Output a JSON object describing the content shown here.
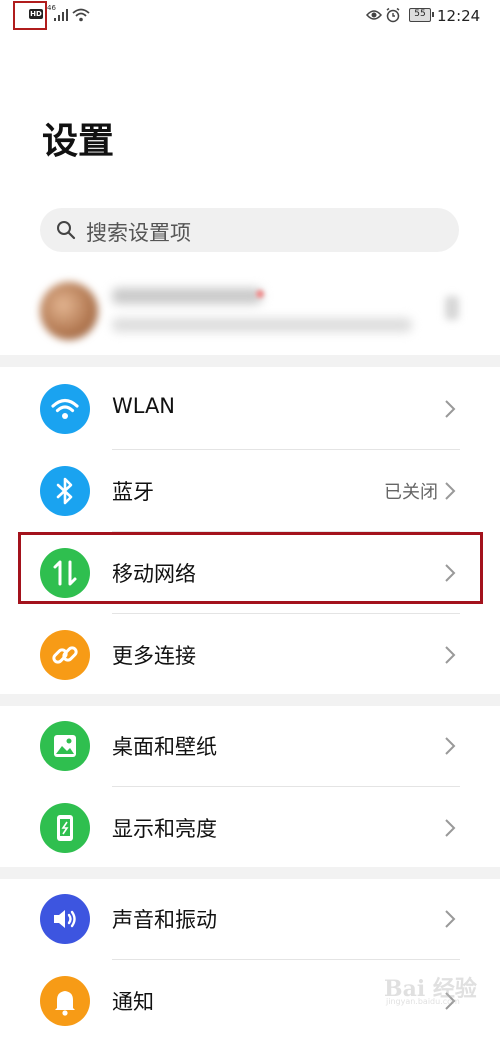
{
  "status_bar": {
    "hd_badge": "HD",
    "signal_label": "46",
    "battery": "55",
    "time": "12:24"
  },
  "page": {
    "title": "设置",
    "search_placeholder": "搜索设置项"
  },
  "rows": [
    {
      "id": "wlan",
      "label": "WLAN",
      "value": "",
      "icon": "wifi-icon",
      "color": "#1aa3f0"
    },
    {
      "id": "bluetooth",
      "label": "蓝牙",
      "value": "已关闭",
      "icon": "bluetooth-icon",
      "color": "#1aa3f0"
    },
    {
      "id": "mobile-network",
      "label": "移动网络",
      "value": "",
      "icon": "mobile-data-icon",
      "color": "#2fbf4f"
    },
    {
      "id": "more-connections",
      "label": "更多连接",
      "value": "",
      "icon": "link-icon",
      "color": "#f79b16"
    },
    {
      "id": "home-wallpaper",
      "label": "桌面和壁纸",
      "value": "",
      "icon": "image-icon",
      "color": "#2fbf4f"
    },
    {
      "id": "display-brightness",
      "label": "显示和亮度",
      "value": "",
      "icon": "phone-brightness-icon",
      "color": "#2fbf4f"
    },
    {
      "id": "sound-vibration",
      "label": "声音和振动",
      "value": "",
      "icon": "speaker-icon",
      "color": "#3d55e0"
    },
    {
      "id": "notifications",
      "label": "通知",
      "value": "",
      "icon": "bell-icon",
      "color": "#f79b16"
    }
  ],
  "watermark": {
    "text": "Bai 经验",
    "sub": "jingyan.baidu.com"
  }
}
